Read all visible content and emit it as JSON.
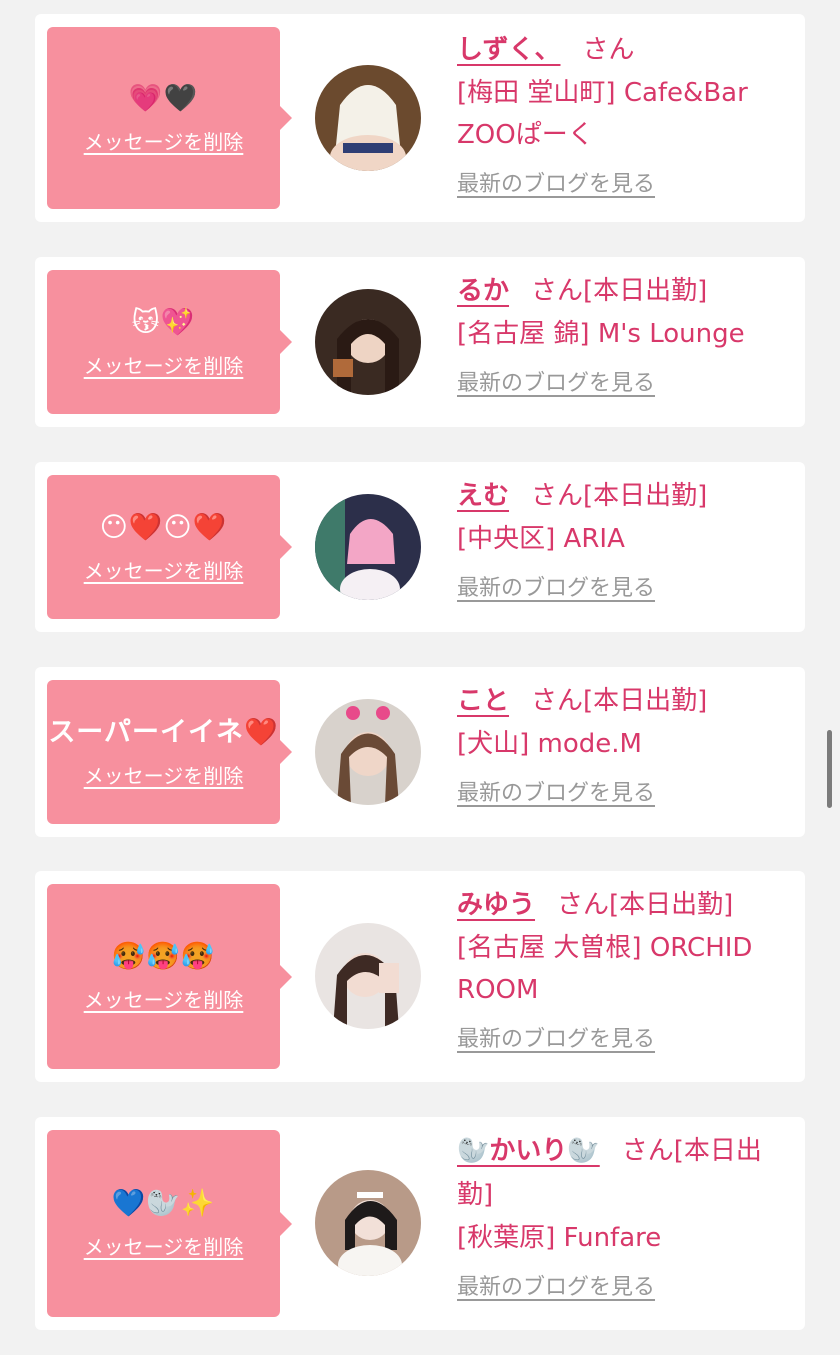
{
  "delete_label": "メッセージを削除",
  "blog_label": "最新のブログを見る",
  "cards": [
    {
      "message": "💗🖤",
      "name": "しずく、",
      "san": "さん",
      "shop": "[梅田 堂山町] Cafe&Bar ZOOぱーく",
      "avatar": "avatar-shizuku"
    },
    {
      "message": "😽💖",
      "name": "るか",
      "san": "さん[本日出勤]",
      "shop": "[名古屋 錦] M's Lounge",
      "avatar": "avatar-ruka"
    },
    {
      "message": "😶❤️😶❤️",
      "name": "えむ",
      "san": "さん[本日出勤]",
      "shop": "[中央区] ARIA",
      "avatar": "avatar-emu"
    },
    {
      "message": "スーパーイイネ❤️",
      "name": "こと",
      "san": "さん[本日出勤]",
      "shop": "[犬山] mode.M",
      "avatar": "avatar-koto"
    },
    {
      "message": "🥵🥵🥵",
      "name": "みゆう",
      "san": "さん[本日出勤]",
      "shop": "[名古屋 大曽根] ORCHID ROOM",
      "avatar": "avatar-miyu"
    },
    {
      "message": "💙🦭✨",
      "name": "🦭かいり🦭",
      "san": "さん[本日出勤]",
      "shop": "[秋葉原] Funfare",
      "avatar": "avatar-kairi"
    }
  ],
  "colors": {
    "accent": "#d8386a",
    "bubble": "#f7909e",
    "muted": "#999999",
    "background": "#f2f2f2"
  }
}
